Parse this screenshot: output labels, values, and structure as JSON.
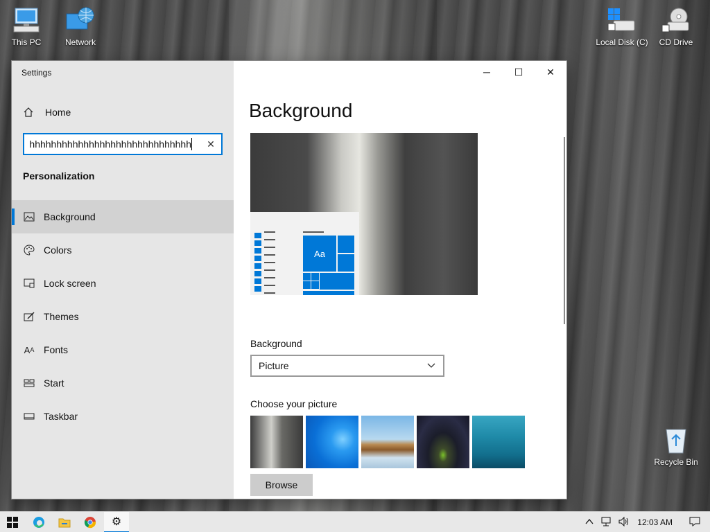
{
  "desktop": {
    "icons": [
      {
        "label": "This PC",
        "icon": "computer-icon"
      },
      {
        "label": "Network",
        "icon": "network-icon"
      },
      {
        "label": "Local Disk (C)",
        "icon": "drive-icon"
      },
      {
        "label": "CD Drive",
        "icon": "cd-drive-icon"
      },
      {
        "label": "Recycle Bin",
        "icon": "recycle-bin-icon"
      }
    ]
  },
  "window": {
    "title": "Settings",
    "minimize": "─",
    "maximize": "☐",
    "close": "✕"
  },
  "sidebar": {
    "home_label": "Home",
    "search_value": "hhhhhhhhhhhhhhhhhhhhhhhhhhhhhhhh",
    "clear_glyph": "✕",
    "section_title": "Personalization",
    "items": [
      {
        "label": "Background",
        "icon": "image-icon",
        "glyph": "▭"
      },
      {
        "label": "Colors",
        "icon": "palette-icon",
        "glyph": "◎"
      },
      {
        "label": "Lock screen",
        "icon": "lock-screen-icon",
        "glyph": "▣"
      },
      {
        "label": "Themes",
        "icon": "themes-icon",
        "glyph": "✎"
      },
      {
        "label": "Fonts",
        "icon": "fonts-icon",
        "glyph": "A"
      },
      {
        "label": "Start",
        "icon": "start-icon",
        "glyph": "▦"
      },
      {
        "label": "Taskbar",
        "icon": "taskbar-icon",
        "glyph": "▭"
      }
    ],
    "active_index": 0
  },
  "content": {
    "title": "Background",
    "preview_tile_text": "Aa",
    "background_label": "Background",
    "background_value": "Picture",
    "choose_label": "Choose your picture",
    "browse_label": "Browse"
  },
  "taskbar": {
    "time": "12:03 AM",
    "apps": [
      "start-icon",
      "edge-icon",
      "file-explorer-icon",
      "chrome-icon",
      "settings-icon"
    ]
  },
  "colors": {
    "accent": "#0078d7"
  }
}
